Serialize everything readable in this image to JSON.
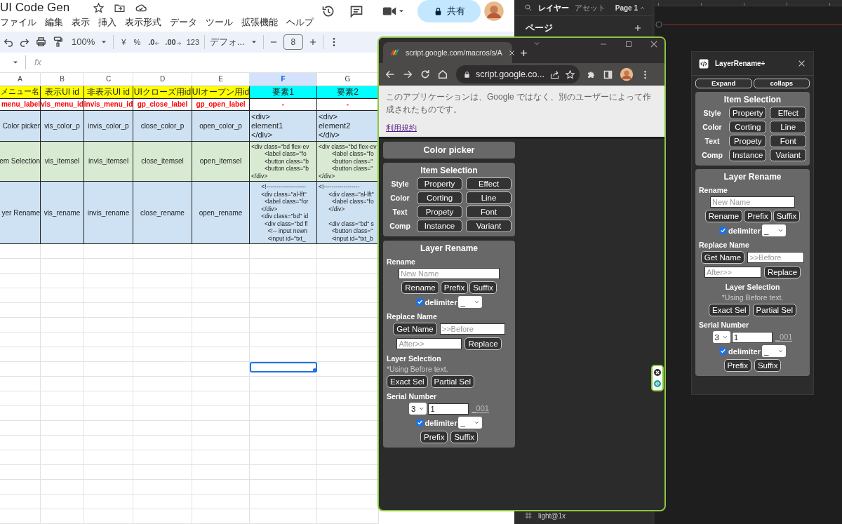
{
  "sheets": {
    "title": "UI Code Gen",
    "menus": [
      "ファイル",
      "編集",
      "表示",
      "挿入",
      "表示形式",
      "データ",
      "ツール",
      "拡張機能",
      "ヘルプ"
    ],
    "share": {
      "label": "共有"
    },
    "toolbar": {
      "zoom": "100%",
      "currency": "¥",
      "percent": "%",
      "decimal_less": ".0",
      "decimal_more": ".00",
      "number_format": "123",
      "font": "デフォ...",
      "font_size": "8"
    },
    "formula_bar": {
      "label": "fx"
    },
    "columns": [
      {
        "label": "A",
        "selected": false
      },
      {
        "label": "B",
        "selected": false
      },
      {
        "label": "C",
        "selected": false
      },
      {
        "label": "D",
        "selected": false
      },
      {
        "label": "E",
        "selected": false
      },
      {
        "label": "F",
        "selected": true
      },
      {
        "label": "G",
        "selected": false
      }
    ],
    "rows": [
      {
        "kind": "header",
        "cells": [
          {
            "text": "メニュー名",
            "color": "#ffff00"
          },
          {
            "text": "表示UI id",
            "color": "#ffff00"
          },
          {
            "text": "非表示UI id",
            "color": "#ffff00"
          },
          {
            "text": "UIクローズ用id",
            "color": "#ffff00"
          },
          {
            "text": "UIオープン用id",
            "color": "#ffff00"
          },
          {
            "text": "要素1",
            "color": "#00ffff"
          },
          {
            "text": "要素2",
            "color": "#00ffff"
          }
        ]
      },
      {
        "kind": "key",
        "cells": [
          {
            "text": "menu_label"
          },
          {
            "text": "vis_menu_id"
          },
          {
            "text": "invis_menu_id"
          },
          {
            "text": "gp_close_label"
          },
          {
            "text": "gp_open_label"
          },
          {
            "text": "-"
          },
          {
            "text": "-"
          }
        ]
      },
      {
        "kind": "item",
        "color": "#cfe2f3",
        "cells": [
          {
            "kind": "text",
            "text": "Color picker"
          },
          {
            "kind": "text",
            "text": "vis_color_p"
          },
          {
            "kind": "text",
            "text": "invis_color_p"
          },
          {
            "kind": "text",
            "text": "close_color_p"
          },
          {
            "kind": "text",
            "text": "open_color_p"
          },
          {
            "kind": "markup",
            "text": "<div>\nelement1\n</div>"
          },
          {
            "kind": "markup",
            "text": "<div>\nelement2\n</div>"
          }
        ]
      },
      {
        "kind": "item",
        "color": "#d9ead3",
        "cells": [
          {
            "kind": "text",
            "text": "em Selection"
          },
          {
            "kind": "text",
            "text": "vis_itemsel"
          },
          {
            "kind": "text",
            "text": "invis_itemsel"
          },
          {
            "kind": "text",
            "text": "close_itemsel"
          },
          {
            "kind": "text",
            "text": "open_itemsel"
          },
          {
            "kind": "code",
            "text": "<div class=\"bd flex-ev\n        <label class=\"fo\n        <button class=\"b\n        <button class=\"b\n</div>"
          },
          {
            "kind": "code",
            "text": "<div class=\"bd flex-ev\n        <label class=\"fo\n        <button class=\"\n        <button class=\"\n</div>"
          }
        ]
      },
      {
        "kind": "item",
        "color": "#cfe2f3",
        "cells": [
          {
            "kind": "text",
            "text": "yer Rename"
          },
          {
            "kind": "text",
            "text": "vis_rename"
          },
          {
            "kind": "text",
            "text": "invis_rename"
          },
          {
            "kind": "text",
            "text": "close_rename"
          },
          {
            "kind": "text",
            "text": "open_rename"
          },
          {
            "kind": "code",
            "text": "      <!--------------------\n      <div class=\"al-lft\"\n        <label class=\"for\n      </div>\n      <div class=\"bd\" id\n        <div class=\"bd fl\n          <!-- input newn\n          <input id=\"txt_"
          },
          {
            "kind": "code",
            "text": "<!------------------\n      <div class=\"al-lft\"\n        <label class=\"fo\n      </div>\n\n      <div class=\"bd\" s\n        <button class=\"\n        <input id=\"txt_b"
          }
        ]
      }
    ],
    "blank_rows": [
      {
        "selected": false
      },
      {
        "selected": false
      },
      {
        "selected": false
      },
      {
        "selected": false
      },
      {
        "selected": false
      },
      {
        "selected": false
      },
      {
        "selected": false
      },
      {
        "selected": false
      },
      {
        "selected": true
      },
      {
        "selected": false
      },
      {
        "selected": false
      },
      {
        "selected": false
      },
      {
        "selected": false
      },
      {
        "selected": false
      },
      {
        "selected": false
      },
      {
        "selected": false
      },
      {
        "selected": false
      },
      {
        "selected": false
      },
      {
        "selected": false
      }
    ]
  },
  "figma": {
    "tabs": [
      {
        "label": "レイヤー",
        "selected": true
      },
      {
        "label": "アセット",
        "selected": false
      }
    ],
    "page_menu": "Page 1",
    "pages_title": "ページ",
    "layer": "light@1x"
  },
  "chrome": {
    "tab": {
      "title": "script.google.com/macros/s/A"
    },
    "address": "script.google.co...",
    "notice": "このアプリケーションは、Google ではなく、別のユーザーによって作成されたものです。",
    "terms_link": "利用規約",
    "app": {
      "banner": "Color picker",
      "item_selection": {
        "title": "Item Selection",
        "rows": [
          {
            "label": "Style",
            "buttons": [
              "Property",
              "Effect"
            ]
          },
          {
            "label": "Color",
            "buttons": [
              "Corting",
              "Line"
            ]
          },
          {
            "label": "Text",
            "buttons": [
              "Propety",
              "Font"
            ]
          },
          {
            "label": "Comp",
            "buttons": [
              "Instance",
              "Variant"
            ]
          }
        ]
      },
      "layer_rename": {
        "title": "Layer Rename",
        "rename": {
          "title": "Rename",
          "placeholder": "New Name",
          "buttons": [
            "Rename",
            "Prefix",
            "Suffix"
          ],
          "delimiter": {
            "label": "delimiter",
            "checked": true,
            "value": "_"
          }
        },
        "replace": {
          "title": "Replace Name",
          "get_button": "Get Name",
          "before_placeholder": ">>Before",
          "after_placeholder": "After>>",
          "replace_button": "Replace"
        },
        "selection": {
          "title": "Layer Selection",
          "note": "*Using Before text.",
          "buttons": [
            "Exact Sel",
            "Partial Sel"
          ]
        },
        "serial": {
          "title": "Serial Number",
          "digits": "3",
          "start": "1",
          "preview": "_001",
          "delimiter": {
            "label": "delimiter",
            "checked": true,
            "value": "_"
          },
          "buttons": [
            "Prefix",
            "Suffix"
          ]
        }
      }
    }
  },
  "plugin": {
    "title": "LayerRename+",
    "toolbar_buttons": [
      "Expand",
      "collaps"
    ],
    "item_selection": {
      "title": "Item Selection",
      "rows": [
        {
          "label": "Style",
          "buttons": [
            "Property",
            "Effect"
          ]
        },
        {
          "label": "Color",
          "buttons": [
            "Corting",
            "Line"
          ]
        },
        {
          "label": "Text",
          "buttons": [
            "Propety",
            "Font"
          ]
        },
        {
          "label": "Comp",
          "buttons": [
            "Instance",
            "Variant"
          ]
        }
      ]
    },
    "layer_rename": {
      "title": "Layer Rename",
      "rename": {
        "title": "Rename",
        "placeholder": "New Name",
        "buttons": [
          "Rename",
          "Prefix",
          "Suffix"
        ],
        "delimiter": {
          "label": "delimiter",
          "checked": true,
          "value": "_"
        }
      },
      "replace": {
        "title": "Replace Name",
        "get_button": "Get Name",
        "before_placeholder": ">>Before",
        "after_placeholder": "After>>",
        "replace_button": "Replace"
      },
      "selection": {
        "title": "Layer Selection",
        "note": "*Using Before text.",
        "buttons": [
          "Exact Sel",
          "Partial Sel"
        ]
      },
      "serial": {
        "title": "Serial Number",
        "digits": "3",
        "start": "1",
        "preview": "_001",
        "delimiter": {
          "label": "delimiter",
          "checked": true,
          "value": "_"
        },
        "buttons": [
          "Prefix",
          "Suffix"
        ]
      }
    }
  }
}
